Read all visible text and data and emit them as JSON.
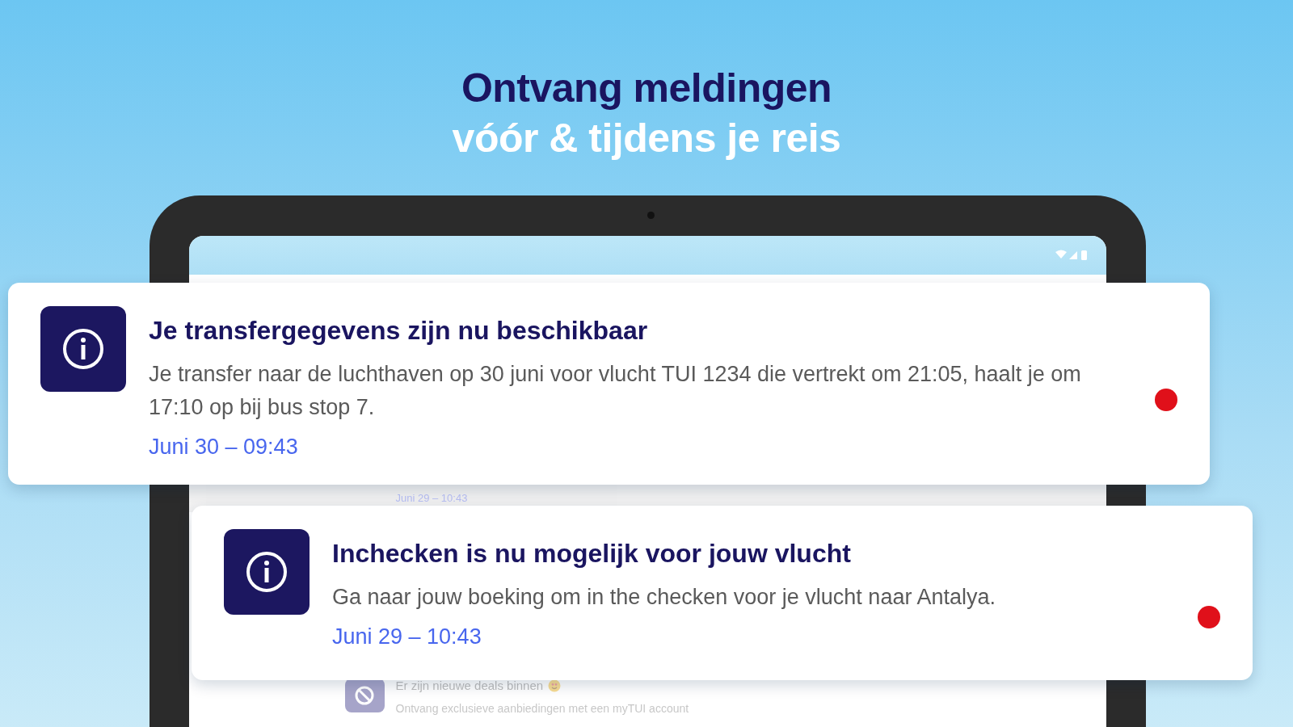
{
  "headline": {
    "line_1": "Ontvang meldingen",
    "line_2": "vóór & tijdens je reis"
  },
  "background_list": [
    {
      "kind": "date",
      "date": "Juni 29 – 10:43"
    },
    {
      "kind": "deal",
      "title": "Er zijn nieuwe deals binnen",
      "body": "Ontvang exclusieve aanbiedingen met een myTUI account"
    }
  ],
  "notifications": [
    {
      "title": "Je transfergegevens zijn nu beschikbaar",
      "body": "Je transfer naar de luchthaven op 30 juni voor vlucht TUI 1234 die vertrekt om 21:05, haalt je om 17:10 op bij bus stop 7.",
      "date": "Juni 30 – 09:43",
      "unread": true
    },
    {
      "title": "Inchecken is nu mogelijk voor jouw vlucht",
      "body": "Ga naar jouw boeking om in the checken voor je vlucht naar Antalya.",
      "date": "Juni 29 – 10:43",
      "unread": true
    }
  ]
}
